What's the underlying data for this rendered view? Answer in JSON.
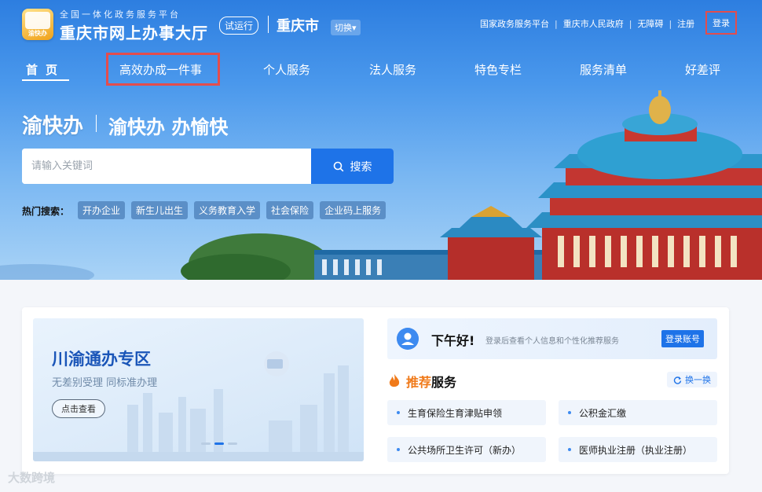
{
  "header": {
    "logo_text": "渝快办",
    "site_subtitle": "全国一体化政务服务平台",
    "site_title": "重庆市网上办事大厅",
    "trial_badge": "试运行",
    "city": "重庆市",
    "switch_label": "切换",
    "top_links": [
      "国家政务服务平台",
      "重庆市人民政府",
      "无障碍",
      "注册"
    ],
    "login": "登录"
  },
  "nav": {
    "items": [
      "首页",
      "高效办成一件事",
      "个人服务",
      "法人服务",
      "特色专栏",
      "服务清单",
      "好差评"
    ]
  },
  "hero": {
    "slogan_main": "渝快办",
    "slogan_sub": "渝快办 办愉快"
  },
  "search": {
    "placeholder": "请输入关键词",
    "button_label": "搜索",
    "hot_label": "热门搜索：",
    "hot_tags": [
      "开办企业",
      "新生儿出生",
      "义务教育入学",
      "社会保险",
      "企业码上服务"
    ]
  },
  "banner": {
    "title": "川渝通办专区",
    "subtitle": "无差别受理  同标准办理",
    "button": "点击查看"
  },
  "greeting": {
    "title": "下午好!",
    "text": "登录后查看个人信息和个性化推荐服务",
    "login_button": "登录账号"
  },
  "recommend": {
    "title_accent": "推荐",
    "title_rest": "服务",
    "swap_label": "换一换",
    "items": [
      "生育保险生育津贴申领",
      "公积金汇缴",
      "公共场所卫生许可（新办）",
      "医师执业注册（执业注册）"
    ]
  },
  "watermark": "大数跨境",
  "colors": {
    "primary": "#1e73e8",
    "highlight": "#e34d4d",
    "accent": "#f07a1a"
  }
}
